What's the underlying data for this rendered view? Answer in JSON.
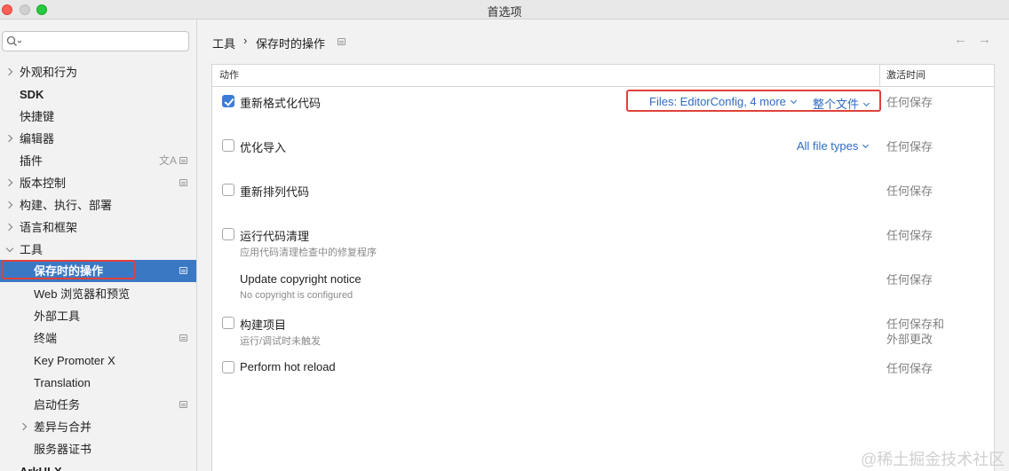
{
  "window": {
    "title": "首选项"
  },
  "search": {
    "placeholder": ""
  },
  "sidebar": {
    "items": [
      {
        "label": "外观和行为"
      },
      {
        "label": "SDK"
      },
      {
        "label": "快捷键"
      },
      {
        "label": "编辑器"
      },
      {
        "label": "插件"
      },
      {
        "label": "版本控制"
      },
      {
        "label": "构建、执行、部署"
      },
      {
        "label": "语言和框架"
      },
      {
        "label": "工具"
      },
      {
        "label": "保存时的操作"
      },
      {
        "label": "Web 浏览器和预览"
      },
      {
        "label": "外部工具"
      },
      {
        "label": "终端"
      },
      {
        "label": "Key Promoter X"
      },
      {
        "label": "Translation"
      },
      {
        "label": "启动任务"
      },
      {
        "label": "差异与合并"
      },
      {
        "label": "服务器证书"
      },
      {
        "label": "ArkUI-X"
      }
    ]
  },
  "breadcrumb": {
    "parent": "工具",
    "separator": "›",
    "current": "保存时的操作"
  },
  "nav": {
    "back": "←",
    "forward": "→"
  },
  "table": {
    "headers": {
      "action": "动作",
      "trigger": "激活时间"
    },
    "rows": [
      {
        "label": "重新格式化代码",
        "checked": true,
        "sub": "",
        "link1": "Files: EditorConfig, 4 more",
        "link2": "整个文件",
        "trigger": "任何保存"
      },
      {
        "label": "优化导入",
        "checked": false,
        "sub": "",
        "link1": "All file types",
        "trigger": "任何保存"
      },
      {
        "label": "重新排列代码",
        "checked": false,
        "sub": "",
        "trigger": "任何保存"
      },
      {
        "label": "运行代码清理",
        "checked": false,
        "sub": "应用代码清理检查中的修复程序",
        "trigger": "任何保存"
      },
      {
        "label": "Update copyright notice",
        "checked": false,
        "sub": "No copyright is configured",
        "trigger": "任何保存"
      },
      {
        "label": "构建项目",
        "checked": false,
        "sub": "运行/调试时未触发",
        "trigger": "任何保存和\n外部更改"
      },
      {
        "label": "Perform hot reload",
        "checked": false,
        "sub": "",
        "trigger": "任何保存"
      }
    ]
  },
  "watermark": "@稀土掘金技术社区",
  "colors": {
    "selection": "#3b78c4",
    "link": "#2f6bbf",
    "highlight_box": "#e0413a",
    "checkbox_checked": "#3d7cd8"
  }
}
